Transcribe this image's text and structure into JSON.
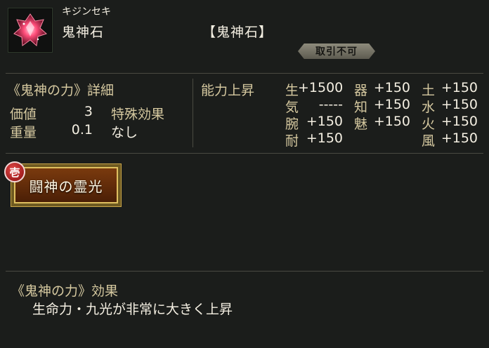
{
  "item": {
    "icon": "red-crystal-icon",
    "furigana": "キジンセキ",
    "name": "鬼神石",
    "bracket_name": "【鬼神石】",
    "trade_status": "取引不可"
  },
  "details": {
    "header": "《鬼神の力》詳細",
    "value_label": "価値",
    "value": "3",
    "weight_label": "重量",
    "weight": "0.1",
    "special_label": "特殊効果",
    "special_value": "なし"
  },
  "ability": {
    "header": "能力上昇",
    "stats": [
      {
        "label": "生",
        "value": "+1500"
      },
      {
        "label": "器",
        "value": "+150"
      },
      {
        "label": "土",
        "value": "+150"
      },
      {
        "label": "気",
        "value": "-----"
      },
      {
        "label": "知",
        "value": "+150"
      },
      {
        "label": "水",
        "value": "+150"
      },
      {
        "label": "腕",
        "value": "+150"
      },
      {
        "label": "魅",
        "value": "+150"
      },
      {
        "label": "火",
        "value": "+150"
      },
      {
        "label": "耐",
        "value": "+150"
      },
      {
        "label": "風",
        "value": "+150"
      }
    ]
  },
  "skill": {
    "rank": "壱",
    "name": "闘神の霊光"
  },
  "effect": {
    "header": "《鬼神の力》効果",
    "description": "生命力・九光が非常に大きく上昇"
  },
  "colors": {
    "background": "#1b1d1b",
    "label_text": "#d6c9a0",
    "value_text": "#f4efe2",
    "badge": "#8e8b7c",
    "skill_plate": "#7a3a0e",
    "rank_badge": "#c41e1e"
  }
}
